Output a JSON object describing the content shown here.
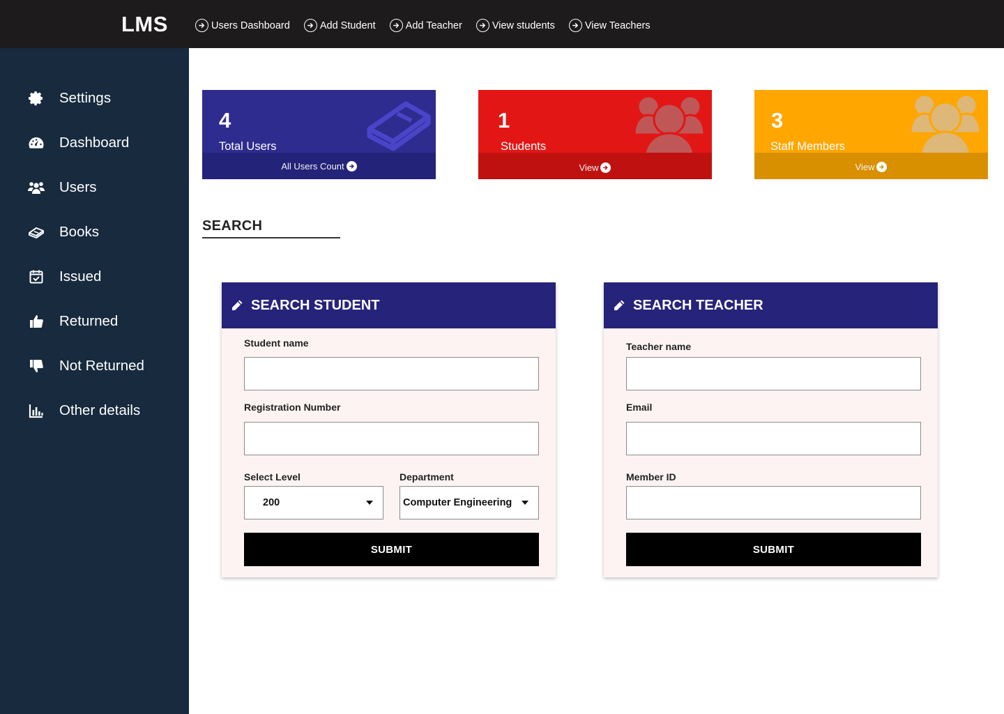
{
  "app": {
    "brand": "LMS"
  },
  "topnav": [
    {
      "label": "Users Dashboard",
      "icon": "arrow-circle-right-icon"
    },
    {
      "label": "Add Student",
      "icon": "arrow-circle-right-icon"
    },
    {
      "label": "Add Teacher",
      "icon": "arrow-circle-right-icon"
    },
    {
      "label": "View students",
      "icon": "arrow-circle-right-icon"
    },
    {
      "label": "View Teachers",
      "icon": "arrow-circle-right-icon"
    }
  ],
  "sidebar": {
    "items": [
      {
        "label": "Settings",
        "icon": "gear-icon"
      },
      {
        "label": "Dashboard",
        "icon": "speedometer-icon"
      },
      {
        "label": "Users",
        "icon": "users-icon"
      },
      {
        "label": "Books",
        "icon": "book-icon"
      },
      {
        "label": "Issued",
        "icon": "calendar-check-icon"
      },
      {
        "label": "Returned",
        "icon": "thumbs-up-icon"
      },
      {
        "label": "Not Returned",
        "icon": "thumbs-down-icon"
      },
      {
        "label": "Other details",
        "icon": "bar-chart-icon"
      }
    ]
  },
  "cards": [
    {
      "count": "4",
      "label": "Total Users",
      "footer": "All Users Count",
      "icon": "book-icon",
      "color": "#2f2c8f"
    },
    {
      "count": "1",
      "label": "Students",
      "footer": "View",
      "icon": "users-icon",
      "color": "#e31616"
    },
    {
      "count": "3",
      "label": "Staff Members",
      "footer": "View",
      "icon": "users-icon",
      "color": "#ffa600"
    }
  ],
  "search": {
    "title": "SEARCH"
  },
  "student_panel": {
    "title": "SEARCH STUDENT",
    "name_label": "Student name",
    "name_value": "",
    "reg_label": "Registration Number",
    "reg_value": "",
    "level_label": "Select Level",
    "level_value": "200",
    "dept_label": "Department",
    "dept_value": "Computer Engineering",
    "submit": "SUBMIT"
  },
  "teacher_panel": {
    "title": "SEARCH TEACHER",
    "name_label": "Teacher name",
    "name_value": "",
    "email_label": "Email",
    "email_value": "",
    "member_label": "Member ID",
    "member_value": "",
    "submit": "SUBMIT"
  },
  "colors": {
    "topbar": "#1e1b1c",
    "sidebar": "#172a3e",
    "panel_header": "#26237a",
    "panel_bg": "#fdf3f3"
  }
}
